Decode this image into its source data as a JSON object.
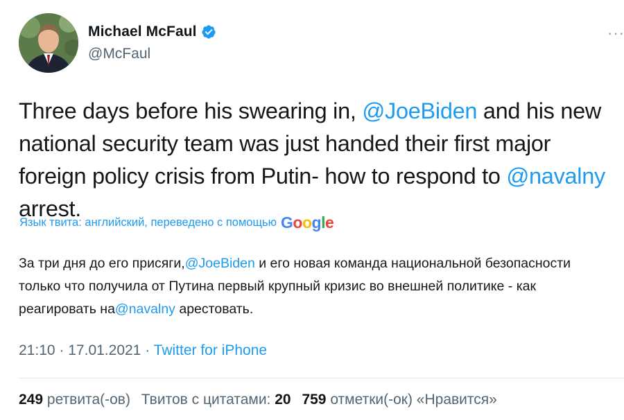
{
  "author": {
    "display_name": "Michael McFaul",
    "handle": "@McFaul"
  },
  "tweet": {
    "text_parts": [
      {
        "text": "Three days before his swearing in, ",
        "mention": false
      },
      {
        "text": "@JoeBiden",
        "mention": true
      },
      {
        "text": " and his new national security team was just handed their first major foreign policy crisis from Putin- how to respond to ",
        "mention": false
      },
      {
        "text": "@navalny",
        "mention": true
      },
      {
        "text": " arrest.",
        "mention": false
      }
    ]
  },
  "translation": {
    "label": "Язык твита: английский, переведено с помощью",
    "provider": "Google",
    "text_parts": [
      {
        "text": "За три дня до его присяги,",
        "mention": false
      },
      {
        "text": "@JoeBiden",
        "mention": true
      },
      {
        "text": " и его новая команда национальной безопасности только что получила от Путина первый крупный кризис во внешней политике - как реагировать на",
        "mention": false
      },
      {
        "text": "@navalny",
        "mention": true
      },
      {
        "text": " арестовать.",
        "mention": false
      }
    ]
  },
  "meta": {
    "time": "21:10",
    "separator": "·",
    "date": "17.01.2021",
    "source": "Twitter for iPhone"
  },
  "stats": {
    "retweets_count": "249",
    "retweets_label": "ретвита(-ов)",
    "quotes_label": "Твитов с цитатами:",
    "quotes_count": "20",
    "likes_count": "759",
    "likes_label": "отметки(-ок) «Нравится»"
  },
  "colors": {
    "accent": "#1d9bf0",
    "text": "#14171a",
    "secondary": "#536471",
    "verified": "#1d9bf0"
  }
}
